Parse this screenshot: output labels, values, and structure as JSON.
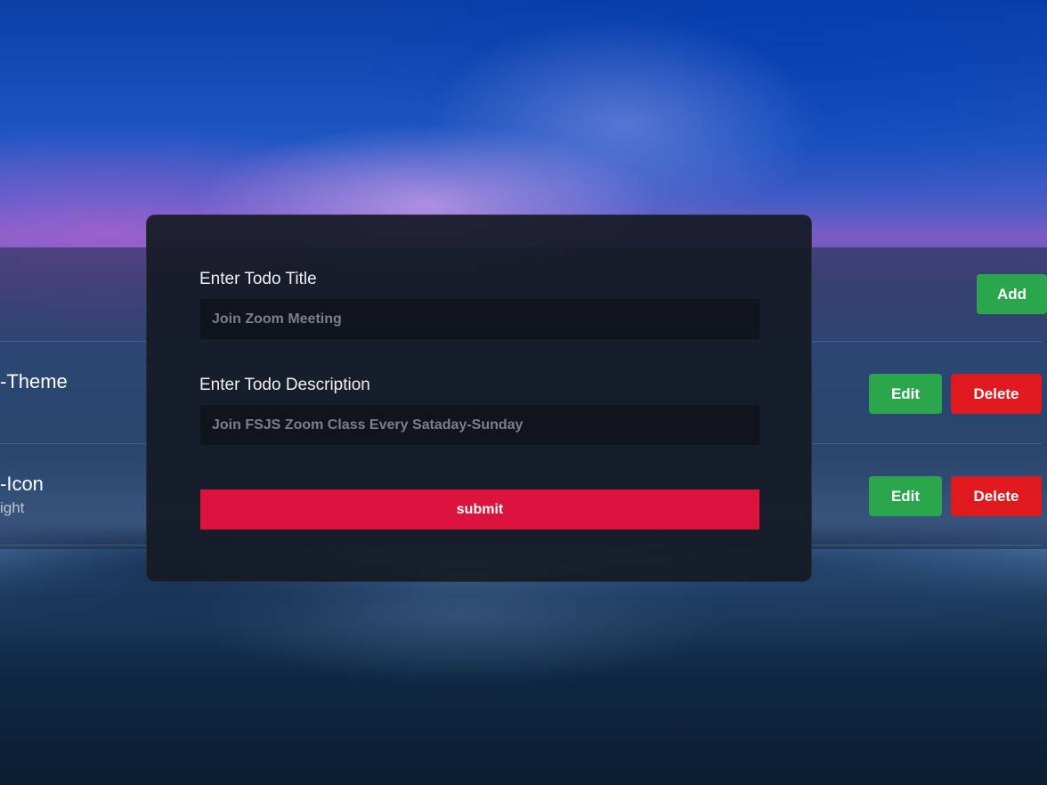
{
  "todo_list": {
    "add_label": "Add",
    "items": [
      {
        "title": "-Theme",
        "description": "",
        "edit_label": "Edit",
        "delete_label": "Delete"
      },
      {
        "title": "-Icon",
        "description": "ight",
        "edit_label": "Edit",
        "delete_label": "Delete"
      }
    ]
  },
  "todo_form": {
    "title_label": "Enter Todo Title",
    "title_placeholder": "Join Zoom Meeting",
    "description_label": "Enter Todo Description",
    "description_placeholder": "Join FSJS Zoom Class Every Sataday-Sunday",
    "submit_label": "submit"
  },
  "colors": {
    "add_button": "#2ca64c",
    "edit_button": "#2ca64c",
    "delete_button": "#e0191f",
    "submit_button": "#dc133c",
    "modal_background": "#161b26",
    "input_background": "#10141c"
  }
}
